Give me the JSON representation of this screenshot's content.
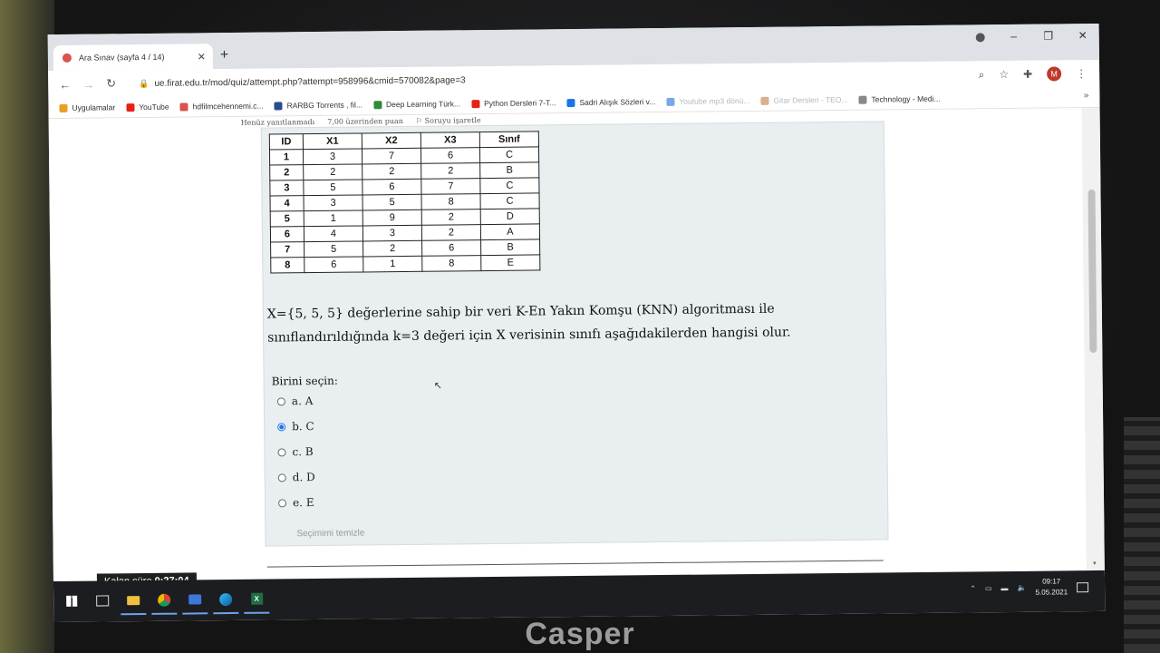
{
  "browser": {
    "tab_title": "Ara Sınav (sayfa 4 / 14)",
    "url": "ue.firat.edu.tr/mod/quiz/attempt.php?attempt=958996&cmid=570082&page=3",
    "avatar_letter": "M",
    "bookmarks": [
      {
        "label": "Uygulamalar",
        "color": "#e8a020"
      },
      {
        "label": "YouTube",
        "color": "#e62117"
      },
      {
        "label": "hdfilmcehennemi.c...",
        "color": "#d9534f"
      },
      {
        "label": "RARBG Torrents , fil...",
        "color": "#2a4b8d"
      },
      {
        "label": "Deep Learning Türk...",
        "color": "#2e8b3a"
      },
      {
        "label": "Python Dersleri 7-T...",
        "color": "#e62117"
      },
      {
        "label": "Sadri Alışık Sözleri v...",
        "color": "#1a73e8"
      },
      {
        "label": "Youtube mp3 dönü...",
        "color": "#7aa7e6",
        "faded": true
      },
      {
        "label": "Gitar Dersleri - TEO...",
        "color": "#d8b090",
        "faded": true
      },
      {
        "label": "Technology - Medi...",
        "color": "#888888"
      }
    ]
  },
  "question": {
    "status": "Henüz yanıtlanmadı",
    "points": "7,00 üzerinden puan",
    "flag": "Soruyu işaretle",
    "text": "X={5, 5, 5} değerlerine sahip bir veri K-En Yakın Komşu (KNN) algoritması ile sınıflandırıldığında k=3 değeri için X verisinin sınıfı aşağıdakilerden hangisi olur.",
    "prompt": "Birini seçin:",
    "options": [
      {
        "label": "a. A",
        "selected": false
      },
      {
        "label": "b. C",
        "selected": true
      },
      {
        "label": "c. B",
        "selected": false
      },
      {
        "label": "d. D",
        "selected": false
      },
      {
        "label": "e. E",
        "selected": false
      }
    ],
    "clear_label": "Seçimimi temizle"
  },
  "table": {
    "headers": [
      "ID",
      "X1",
      "X2",
      "X3",
      "Sınıf"
    ],
    "rows": [
      [
        "1",
        "3",
        "7",
        "6",
        "C"
      ],
      [
        "2",
        "2",
        "2",
        "2",
        "B"
      ],
      [
        "3",
        "5",
        "6",
        "7",
        "C"
      ],
      [
        "4",
        "3",
        "5",
        "8",
        "C"
      ],
      [
        "5",
        "1",
        "9",
        "2",
        "D"
      ],
      [
        "6",
        "4",
        "3",
        "2",
        "A"
      ],
      [
        "7",
        "5",
        "2",
        "6",
        "B"
      ],
      [
        "8",
        "6",
        "1",
        "8",
        "E"
      ]
    ]
  },
  "timer": {
    "label": "Kalan süre",
    "value": "0:27:04"
  },
  "taskbar": {
    "time": "09:17",
    "date": "5.05.2021"
  },
  "device_brand": "Casper"
}
